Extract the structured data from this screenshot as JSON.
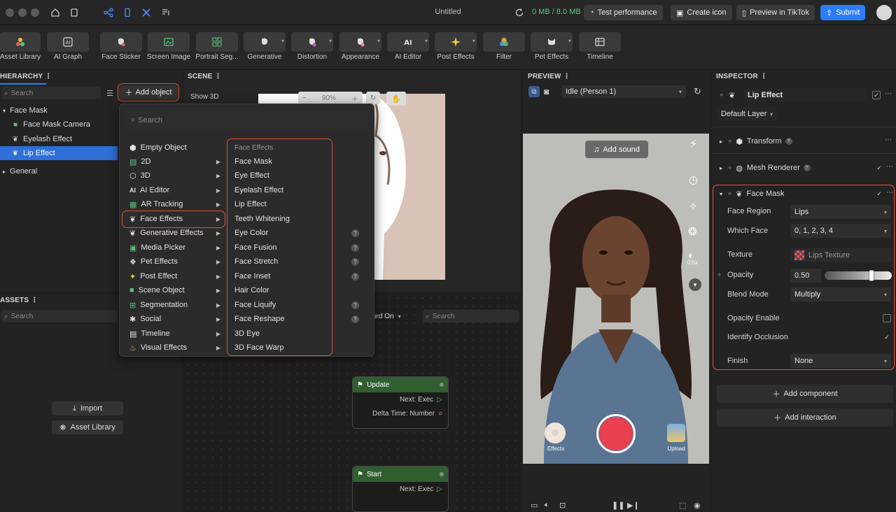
{
  "titlebar": {
    "title": "Untitled",
    "memory": "0 MB / 8.0 MB",
    "test_performance": "Test performance",
    "create_icon": "Create icon",
    "preview_in_tiktok": "Preview in TikTok",
    "submit": "Submit"
  },
  "toolbar": {
    "items": [
      {
        "label": "Asset Library"
      },
      {
        "label": "AI Graph"
      },
      {
        "label": "Face Sticker"
      },
      {
        "label": "Screen Image"
      },
      {
        "label": "Portrait Seg..."
      },
      {
        "label": "Generative"
      },
      {
        "label": "Distortion"
      },
      {
        "label": "Appearance"
      },
      {
        "label": "AI Editor"
      },
      {
        "label": "Post Effects"
      },
      {
        "label": "Filter"
      },
      {
        "label": "Pet Effects"
      },
      {
        "label": "Timeline"
      }
    ]
  },
  "hierarchy": {
    "title": "HIERARCHY",
    "search_placeholder": "Search",
    "add_object": "Add object",
    "tree": [
      {
        "label": "Face Mask"
      },
      {
        "label": "Face Mask Camera"
      },
      {
        "label": "Eyelash Effect"
      },
      {
        "label": "Lip Effect"
      },
      {
        "label": "General"
      }
    ]
  },
  "assets": {
    "title": "ASSETS",
    "search_placeholder": "Search",
    "import": "Import",
    "asset_library": "Asset Library"
  },
  "scene": {
    "title": "SCENE",
    "show3d": "Show 3D",
    "zoom": "90%"
  },
  "add_menu": {
    "search_placeholder": "Search",
    "categories": [
      {
        "label": "Empty Object"
      },
      {
        "label": "2D"
      },
      {
        "label": "3D"
      },
      {
        "label": "AI Editor"
      },
      {
        "label": "AR Tracking"
      },
      {
        "label": "Face Effects"
      },
      {
        "label": "Generative Effects"
      },
      {
        "label": "Media Picker"
      },
      {
        "label": "Pet Effects"
      },
      {
        "label": "Post Effect"
      },
      {
        "label": "Scene Object"
      },
      {
        "label": "Segmentation"
      },
      {
        "label": "Social"
      },
      {
        "label": "Timeline"
      },
      {
        "label": "Visual Effects"
      }
    ],
    "sub_header": "Face Effects",
    "sub_items": [
      {
        "label": "Face Mask"
      },
      {
        "label": "Eye Effect"
      },
      {
        "label": "Eyelash Effect"
      },
      {
        "label": "Lip Effect"
      },
      {
        "label": "Teeth Whitening"
      },
      {
        "label": "Eye Color"
      },
      {
        "label": "Face Fusion"
      },
      {
        "label": "Face Stretch"
      },
      {
        "label": "Face Inset"
      },
      {
        "label": "Hair Color"
      },
      {
        "label": "Face Liquify"
      },
      {
        "label": "Face Reshape"
      },
      {
        "label": "3D Eye"
      },
      {
        "label": "3D Face Warp"
      }
    ]
  },
  "graph": {
    "record": "ord On",
    "search_placeholder": "Search",
    "update_node": {
      "title": "Update",
      "port1": "Next: Exec",
      "port2": "Delta Time: Number"
    },
    "start_node": {
      "title": "Start",
      "port1": "Next: Exec"
    }
  },
  "preview": {
    "title": "PREVIEW",
    "person": "Idle (Person 1)",
    "add_sound": "Add sound",
    "speed": "0.5x",
    "effects": "Effects",
    "upload": "Upload"
  },
  "inspector": {
    "title": "INSPECTOR",
    "object_name": "Lip Effect",
    "layer": "Default Layer",
    "transform": "Transform",
    "mesh_renderer": "Mesh Renderer",
    "face_mask": "Face Mask",
    "face_region_label": "Face Region",
    "face_region_value": "Lips",
    "which_face_label": "Which Face",
    "which_face_value": "0, 1, 2, 3, 4",
    "texture_label": "Texture",
    "texture_value": "Lips Texture",
    "opacity_label": "Opacity",
    "opacity_value": "0.50",
    "opacity_fraction": 0.5,
    "blend_mode_label": "Blend Mode",
    "blend_mode_value": "Multiply",
    "opacity_enable_label": "Opacity Enable",
    "identify_occlusion_label": "Identify Occlusion",
    "finish_label": "Finish",
    "finish_value": "None",
    "add_component": "Add component",
    "add_interaction": "Add interaction"
  },
  "colors": {
    "accent": "#2c7ef8",
    "highlight": "#e0503a",
    "record": "#e8404e"
  }
}
